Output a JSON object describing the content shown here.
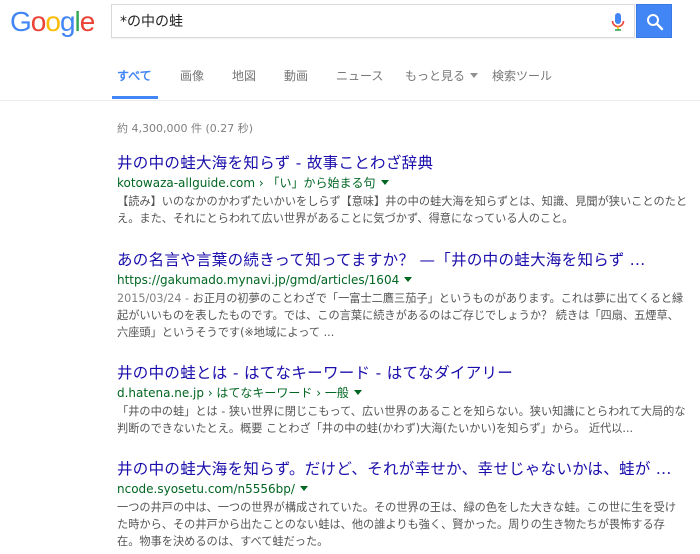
{
  "logo": {
    "letters": [
      "G",
      "o",
      "o",
      "g",
      "l",
      "e"
    ],
    "colors": [
      "#4285f4",
      "#ea4335",
      "#fbbc05",
      "#4285f4",
      "#34a853",
      "#ea4335"
    ]
  },
  "search": {
    "query": "*の中の蛙"
  },
  "tabs": [
    {
      "label": "すべて",
      "active": true
    },
    {
      "label": "画像"
    },
    {
      "label": "地図"
    },
    {
      "label": "動画"
    },
    {
      "label": "ニュース"
    },
    {
      "label": "もっと見る"
    },
    {
      "label": "検索ツール"
    }
  ],
  "stats": "約 4,300,000 件 (0.27 秒)",
  "results": [
    {
      "title": "井の中の蛙大海を知らず - 故事ことわざ辞典",
      "url": "kotowaza-allguide.com › 「い」から始まる句",
      "snippet": "【読み】いのなかのかわずたいかいをしらず【意味】井の中の蛙大海を知らずとは、知識、見聞が狭いことのたとえ。また、それにとらわれて広い世界があることに気づかず、得意になっている人のこと。"
    },
    {
      "title": "あの名言や言葉の続きって知ってますか？ —「井の中の蛙大海を知らず ...",
      "url": "https://gakumado.mynavi.jp/gmd/articles/1604",
      "date": "2015/03/24 - ",
      "snippet": "お正月の初夢のことわざで「一富士二鷹三茄子」というものがあります。これは夢に出てくると縁起がいいものを表したものです。では、この言葉に続きがあるのはご存じでしょうか？ 続きは「四扇、五煙草、六座頭」というそうです(※地域によって ..."
    },
    {
      "title": "井の中の蛙とは - はてなキーワード - はてなダイアリー",
      "url": "d.hatena.ne.jp › はてなキーワード › 一般",
      "snippet": "「井の中の蛙」とは - 狭い世界に閉じこもって、広い世界のあることを知らない。狭い知識にとらわれて大局的な判断のできないたとえ。概要 ことわざ「井の中の蛙(かわず)大海(たいかい)を知らず」から。 近代以..."
    },
    {
      "title": "井の中の蛙大海を知らず。だけど、それが幸せか、幸せじゃないかは、蛙が ...",
      "url": "ncode.syosetu.com/n5556bp/",
      "snippet": "一つの井戸の中は、一つの世界が構成されていた。その世界の王は、緑の色をした大きな蛙。この世に生を受けた時から、その井戸から出たことのない蛙は、他の誰よりも強く、賢かった。周りの生き物たちが畏怖する存在。物事を決めるのは、すべて蛙だった。"
    }
  ]
}
